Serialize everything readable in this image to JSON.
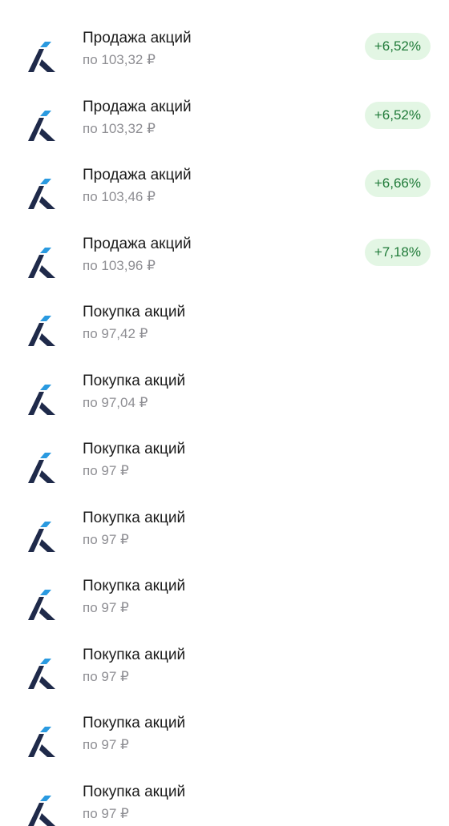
{
  "operations": [
    {
      "title": "Продажа акций",
      "price": "по 103,32 ₽",
      "change": "+6,52%"
    },
    {
      "title": "Продажа акций",
      "price": "по 103,32 ₽",
      "change": "+6,52%"
    },
    {
      "title": "Продажа акций",
      "price": "по 103,46 ₽",
      "change": "+6,66%"
    },
    {
      "title": "Продажа акций",
      "price": "по 103,96 ₽",
      "change": "+7,18%"
    },
    {
      "title": "Покупка акций",
      "price": "по 97,42 ₽"
    },
    {
      "title": "Покупка акций",
      "price": "по 97,04 ₽"
    },
    {
      "title": "Покупка акций",
      "price": "по 97 ₽"
    },
    {
      "title": "Покупка акций",
      "price": "по 97 ₽"
    },
    {
      "title": "Покупка акций",
      "price": "по 97 ₽"
    },
    {
      "title": "Покупка акций",
      "price": "по 97 ₽"
    },
    {
      "title": "Покупка акций",
      "price": "по 97 ₽"
    },
    {
      "title": "Покупка акций",
      "price": "по 97 ₽"
    }
  ],
  "colors": {
    "logo_dark": "#1f2a4a",
    "logo_accent": "#2a9ae0",
    "badge_bg": "#e3f6e4",
    "badge_text": "#1f7a38"
  },
  "icons": {
    "company_logo": "company-logo-icon"
  }
}
